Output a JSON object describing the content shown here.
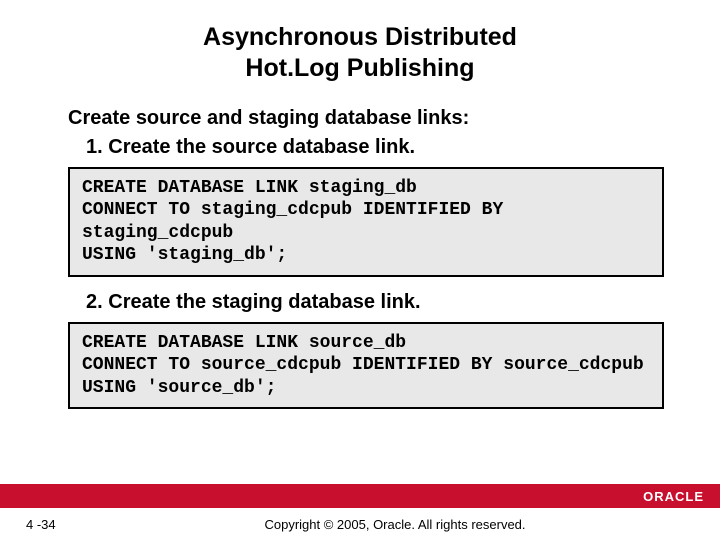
{
  "title_line1": "Asynchronous Distributed",
  "title_line2": "Hot.Log Publishing",
  "lead": "Create source and staging database links:",
  "items": [
    {
      "num": "1.",
      "text": "Create the source database link."
    },
    {
      "num": "2.",
      "text": "Create the staging database link."
    }
  ],
  "codeblocks": [
    "CREATE DATABASE LINK staging_db\nCONNECT TO staging_cdcpub IDENTIFIED BY staging_cdcpub\nUSING 'staging_db';",
    "CREATE DATABASE LINK source_db\nCONNECT TO source_cdcpub IDENTIFIED BY source_cdcpub\nUSING 'source_db';"
  ],
  "footer": {
    "page": "4 -34",
    "copyright": "Copyright © 2005, Oracle.  All rights reserved.",
    "logo": "ORACLE"
  }
}
